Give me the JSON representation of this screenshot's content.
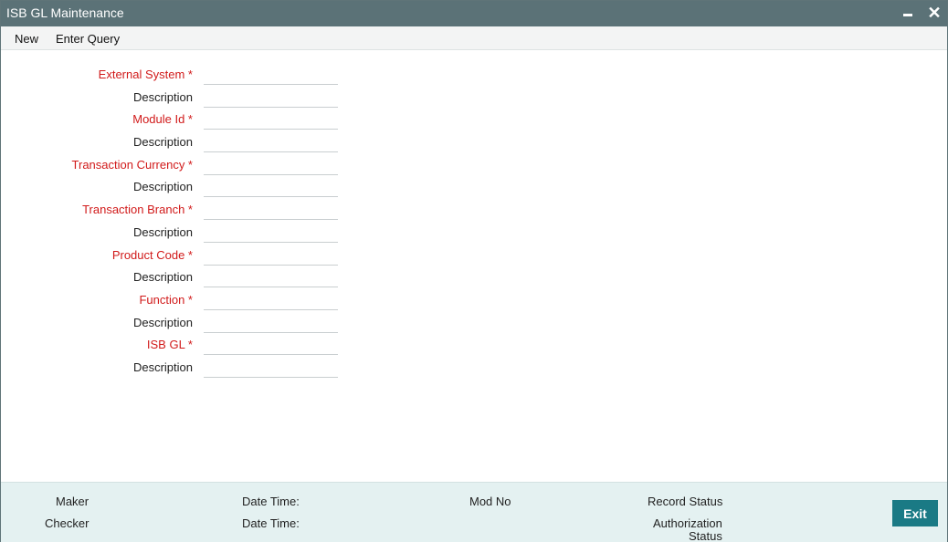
{
  "window": {
    "title": "ISB GL Maintenance",
    "minimize_glyph": "–",
    "close_glyph": "✕"
  },
  "menu": {
    "items": [
      "New",
      "Enter Query"
    ]
  },
  "form": {
    "rows": [
      {
        "label": "External System *",
        "required": true,
        "value": ""
      },
      {
        "label": "Description",
        "required": false,
        "value": ""
      },
      {
        "label": "Module Id *",
        "required": true,
        "value": ""
      },
      {
        "label": "Description",
        "required": false,
        "value": ""
      },
      {
        "label": "Transaction Currency *",
        "required": true,
        "value": ""
      },
      {
        "label": "Description",
        "required": false,
        "value": ""
      },
      {
        "label": "Transaction Branch *",
        "required": true,
        "value": ""
      },
      {
        "label": "Description",
        "required": false,
        "value": ""
      },
      {
        "label": "Product Code *",
        "required": true,
        "value": ""
      },
      {
        "label": "Description",
        "required": false,
        "value": ""
      },
      {
        "label": "Function *",
        "required": true,
        "value": ""
      },
      {
        "label": "Description",
        "required": false,
        "value": ""
      },
      {
        "label": "ISB GL *",
        "required": true,
        "value": ""
      },
      {
        "label": "Description",
        "required": false,
        "value": ""
      }
    ]
  },
  "footer": {
    "maker": "Maker",
    "checker": "Checker",
    "date_time_1": "Date Time:",
    "date_time_2": "Date Time:",
    "mod_no": "Mod No",
    "record_status": "Record Status",
    "authorization_status_line1": "Authorization",
    "authorization_status_line2": "Status",
    "exit_label": "Exit"
  },
  "colors": {
    "titlebar": "#5b7277",
    "required_label": "#d11a1a",
    "footer_bg": "#e4f1f1",
    "exit_button": "#1a7a85"
  }
}
